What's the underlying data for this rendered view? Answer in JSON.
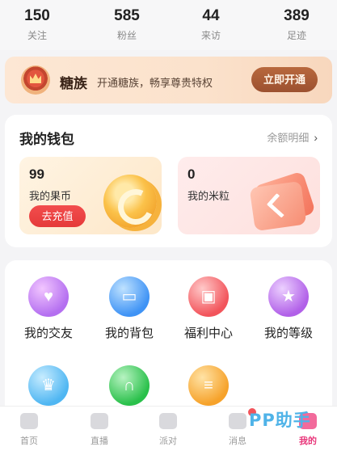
{
  "stats": [
    {
      "value": "150",
      "label": "关注"
    },
    {
      "value": "585",
      "label": "粉丝"
    },
    {
      "value": "44",
      "label": "来访"
    },
    {
      "value": "389",
      "label": "足迹"
    }
  ],
  "vip": {
    "name": "糖族",
    "description": "开通糖族，畅享尊贵特权",
    "button": "立即开通"
  },
  "wallet": {
    "title": "我的钱包",
    "detail_link": "余额明细",
    "chevron": "›",
    "guo": {
      "value": "99",
      "label": "我的果币",
      "button": "去充值"
    },
    "mi": {
      "value": "0",
      "label": "我的米粒"
    }
  },
  "features": [
    {
      "label": "我的交友",
      "icon": "heart-icon"
    },
    {
      "label": "我的背包",
      "icon": "backpack-icon"
    },
    {
      "label": "福利中心",
      "icon": "gift-icon"
    },
    {
      "label": "我的等级",
      "icon": "star-icon"
    },
    {
      "label": "",
      "icon": "crown-icon"
    },
    {
      "label": "",
      "icon": "headphones-icon"
    },
    {
      "label": "",
      "icon": "task-icon"
    }
  ],
  "nav": [
    {
      "label": "首页",
      "icon": "home-icon"
    },
    {
      "label": "直播",
      "icon": "video-icon"
    },
    {
      "label": "派对",
      "icon": "party-icon"
    },
    {
      "label": "消息",
      "icon": "message-icon"
    },
    {
      "label": "我的",
      "icon": "profile-icon",
      "active": true
    }
  ],
  "watermark": "PP助手",
  "colors": {
    "accent": "#e8367a",
    "charge_button": "#e53a3a",
    "vip_button": "#9c5130"
  }
}
